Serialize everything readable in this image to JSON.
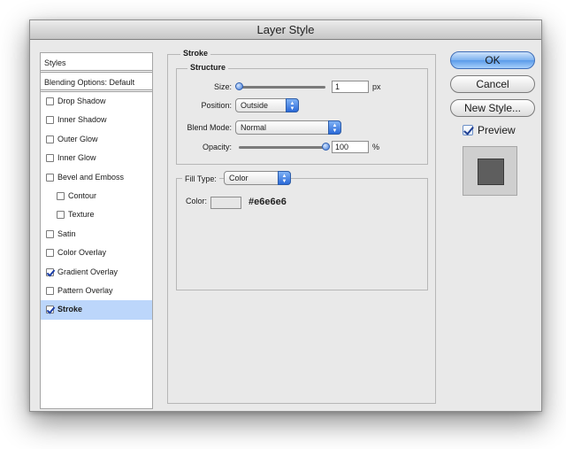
{
  "window": {
    "title": "Layer Style"
  },
  "styles_panel": {
    "header": "Styles",
    "blending_options": "Blending Options: Default",
    "items": [
      {
        "label": "Drop Shadow",
        "checked": false,
        "indent": false,
        "selected": false
      },
      {
        "label": "Inner Shadow",
        "checked": false,
        "indent": false,
        "selected": false
      },
      {
        "label": "Outer Glow",
        "checked": false,
        "indent": false,
        "selected": false
      },
      {
        "label": "Inner Glow",
        "checked": false,
        "indent": false,
        "selected": false
      },
      {
        "label": "Bevel and Emboss",
        "checked": false,
        "indent": false,
        "selected": false
      },
      {
        "label": "Contour",
        "checked": false,
        "indent": true,
        "selected": false
      },
      {
        "label": "Texture",
        "checked": false,
        "indent": true,
        "selected": false
      },
      {
        "label": "Satin",
        "checked": false,
        "indent": false,
        "selected": false
      },
      {
        "label": "Color Overlay",
        "checked": false,
        "indent": false,
        "selected": false
      },
      {
        "label": "Gradient Overlay",
        "checked": true,
        "indent": false,
        "selected": false
      },
      {
        "label": "Pattern Overlay",
        "checked": false,
        "indent": false,
        "selected": false
      },
      {
        "label": "Stroke",
        "checked": true,
        "indent": false,
        "selected": true
      }
    ]
  },
  "stroke": {
    "group_title": "Stroke",
    "structure_title": "Structure",
    "size": {
      "label": "Size:",
      "value": "1",
      "unit": "px",
      "level": 0.0
    },
    "position": {
      "label": "Position:",
      "value": "Outside"
    },
    "blend_mode": {
      "label": "Blend Mode:",
      "value": "Normal"
    },
    "opacity": {
      "label": "Opacity:",
      "value": "100",
      "unit": "%",
      "level": 1.0
    },
    "fill_type": {
      "label": "Fill Type:",
      "value": "Color"
    },
    "color": {
      "label": "Color:",
      "swatch": "#e6e6e6",
      "hex_text": "#e6e6e6"
    }
  },
  "buttons": {
    "ok": "OK",
    "cancel": "Cancel",
    "new_style": "New Style...",
    "preview_label": "Preview",
    "preview_checked": true
  },
  "colors": {
    "selection": "#bcd6fb",
    "accent_blue": "#3f78d8",
    "preview_square": "#5e5e5e"
  }
}
